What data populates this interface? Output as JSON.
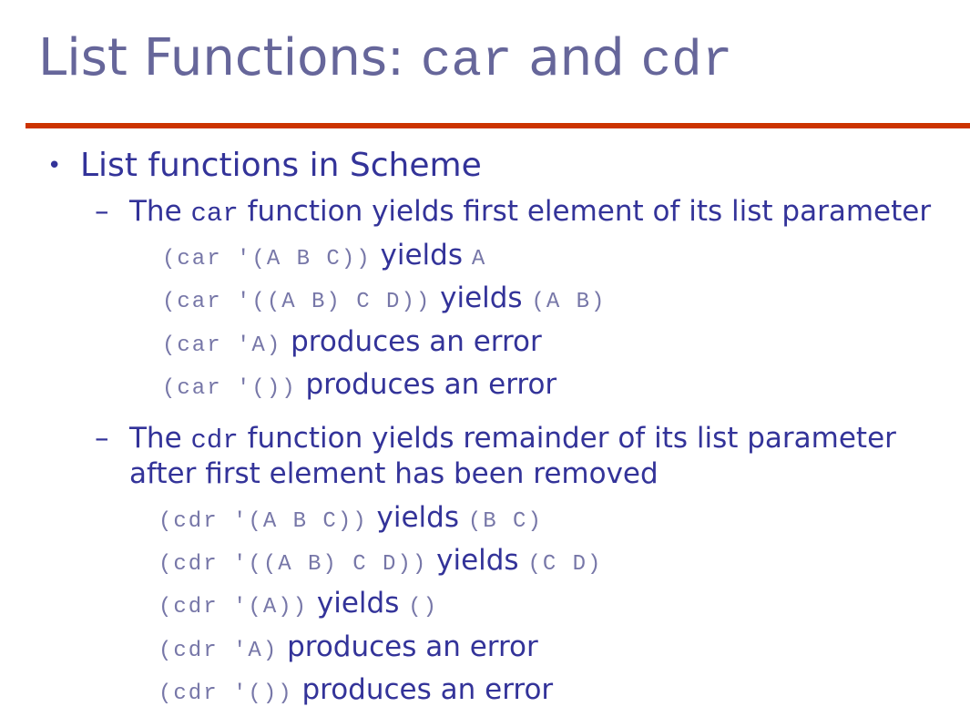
{
  "title": {
    "part1": "List Functions: ",
    "code1": "car",
    "part2": " and ",
    "code2": "cdr"
  },
  "bullet": {
    "marker": "•",
    "text": "List functions in Scheme"
  },
  "car_section": {
    "dash": "–",
    "pre": "The ",
    "code": "car",
    "post": " function yields first element of its list parameter",
    "examples": [
      {
        "code": "(car '(A B C))",
        "word": " yields ",
        "result": "A"
      },
      {
        "code": "(car '((A B) C D))",
        "word": " yields ",
        "result": "(A B)"
      },
      {
        "code": "(car 'A)",
        "word": " produces an error",
        "result": ""
      },
      {
        "code": "(car '())",
        "word": " produces an error",
        "result": ""
      }
    ]
  },
  "cdr_section": {
    "dash": "–",
    "pre": "The ",
    "code": "cdr",
    "post": " function yields remainder of its list parameter",
    "line2": "after first element has been removed",
    "examples": [
      {
        "code": "(cdr '(A B C))",
        "word": " yields ",
        "result": "(B C)"
      },
      {
        "code": "(cdr '((A B) C D))",
        "word": " yields ",
        "result": "(C D)"
      },
      {
        "code": "(cdr '(A))",
        "word": " yields ",
        "result": "()"
      },
      {
        "code": "(cdr 'A)",
        "word": " produces an error",
        "result": ""
      },
      {
        "code": "(cdr '())",
        "word": " produces an error",
        "result": ""
      }
    ]
  },
  "colors": {
    "title": "#66669a",
    "body": "#333399",
    "code": "#7777a8",
    "rule": "#cc3300"
  }
}
